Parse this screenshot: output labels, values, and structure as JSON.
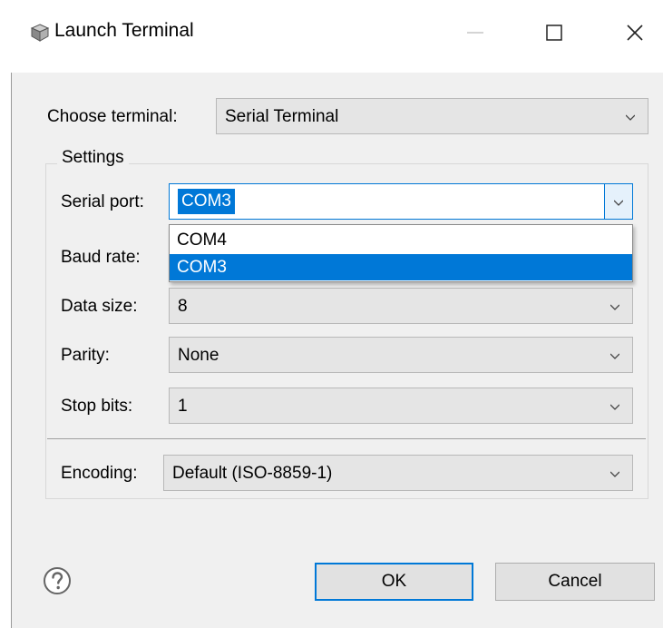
{
  "window": {
    "title": "Launch Terminal"
  },
  "terminal": {
    "label": "Choose terminal:",
    "value": "Serial Terminal"
  },
  "settings": {
    "legend": "Settings",
    "serial_port": {
      "label": "Serial port:",
      "value": "COM3"
    },
    "baud_rate": {
      "label": "Baud rate:"
    },
    "data_size": {
      "label": "Data size:",
      "value": "8"
    },
    "parity": {
      "label": "Parity:",
      "value": "None"
    },
    "stop_bits": {
      "label": "Stop bits:",
      "value": "1"
    },
    "encoding": {
      "label": "Encoding:",
      "value": "Default (ISO-8859-1)"
    }
  },
  "port_dropdown": {
    "options": [
      "COM4",
      "COM3"
    ],
    "selected": "COM3"
  },
  "buttons": {
    "ok": "OK",
    "cancel": "Cancel"
  },
  "colors": {
    "selection": "#0078d7",
    "dialog_bg": "#f0f0f0",
    "combo_bg": "#e5e5e5"
  }
}
